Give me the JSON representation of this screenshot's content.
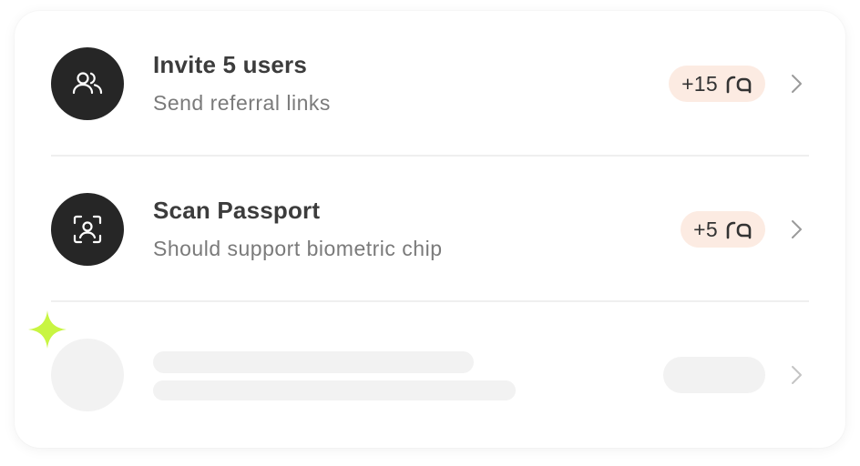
{
  "tasks": [
    {
      "title": "Invite 5 users",
      "subtitle": "Send referral links",
      "reward": "+15",
      "icon": "users-icon"
    },
    {
      "title": "Scan Passport",
      "subtitle": "Should support biometric chip",
      "reward": "+5",
      "icon": "face-scan-icon"
    }
  ],
  "placeholder_row": {
    "state": "loading"
  },
  "colors": {
    "avatar_bg": "#262626",
    "badge_bg": "#fcebe2",
    "skeleton": "#f2f2f2",
    "sparkle": "#c8f542"
  },
  "icons": {
    "reward_logo": "ra-logo",
    "chevron": "chevron-right-icon",
    "sparkle": "sparkle-icon"
  }
}
